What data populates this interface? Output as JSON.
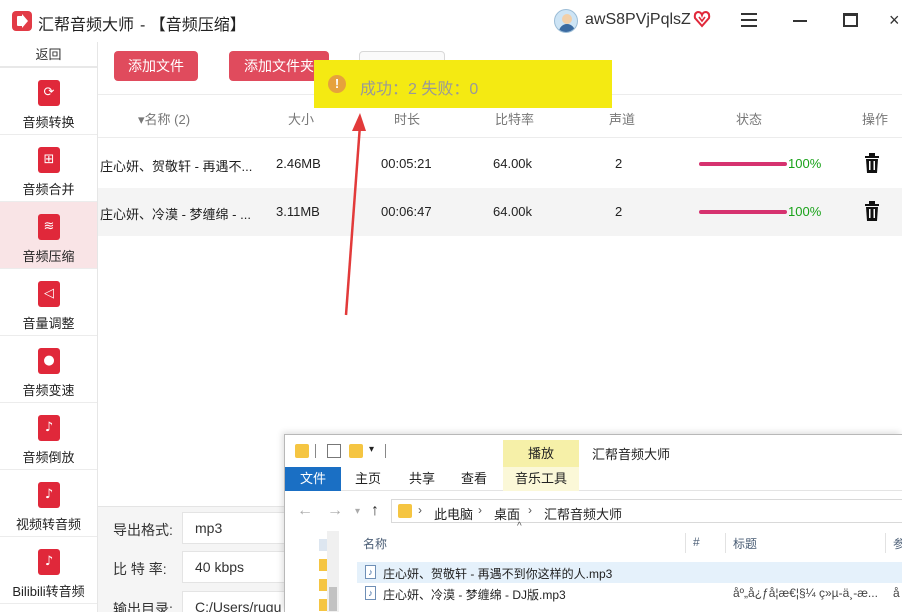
{
  "window": {
    "app_title": "汇帮音频大师",
    "page_tag": "-  【音频压缩】",
    "username": "awS8PVjPqlsZ",
    "close_glyph": "×"
  },
  "sidebar": {
    "back_label": "返回",
    "items": [
      {
        "label": "音频转换",
        "icon": "audio-convert-icon",
        "active": false
      },
      {
        "label": "音频合并",
        "icon": "audio-merge-icon",
        "active": false
      },
      {
        "label": "音频压缩",
        "icon": "audio-compress-icon",
        "active": true
      },
      {
        "label": "音量调整",
        "icon": "volume-icon",
        "active": false
      },
      {
        "label": "音频变速",
        "icon": "microphone-icon",
        "active": false
      },
      {
        "label": "音频倒放",
        "icon": "music-note-icon",
        "active": false
      },
      {
        "label": "视频转音频",
        "icon": "music-note-icon",
        "active": false
      },
      {
        "label": "Bilibili转音频",
        "icon": "music-note-icon",
        "active": false
      }
    ]
  },
  "toolbar": {
    "add_file": "添加文件",
    "add_folder": "添加文件夹"
  },
  "toast": {
    "text": "成功：2    失败：0",
    "icon": "info-icon",
    "color": "#f4ea12"
  },
  "table": {
    "headers": {
      "name": "▾名称 (2)",
      "size": "大小",
      "duration": "时长",
      "bitrate": "比特率",
      "channels": "声道",
      "status": "状态",
      "action": "操作"
    },
    "rows": [
      {
        "name": "庄心妍、贺敬轩 - 再遇不...",
        "size": "2.46MB",
        "duration": "00:05:21",
        "bitrate": "64.00k",
        "channels": "2",
        "progress": 1.0,
        "percent": "100%"
      },
      {
        "name": "庄心妍、冷漠 - 梦缠绵 - ...",
        "size": "3.11MB",
        "duration": "00:06:47",
        "bitrate": "64.00k",
        "channels": "2",
        "progress": 1.0,
        "percent": "100%"
      }
    ]
  },
  "settings": {
    "format_label": "导出格式:",
    "format_value": "mp3",
    "bitrate_label": "比 特 率:",
    "bitrate_value": "40 kbps",
    "output_label": "输出目录:",
    "output_value": "C:/Users/rugu"
  },
  "explorer": {
    "context_tab": "播放",
    "window_title": "汇帮音频大师",
    "ribbon_tabs": [
      "文件",
      "主页",
      "共享",
      "查看",
      "音乐工具"
    ],
    "breadcrumbs": [
      "此电脑",
      "桌面",
      "汇帮音频大师"
    ],
    "columns": [
      "名称",
      "#",
      "标题",
      "参"
    ],
    "files": [
      {
        "name": "庄心妍、贺敬轩 - 再遇不到你这样的人.mp3",
        "title": "",
        "extra": "",
        "selected": true
      },
      {
        "name": "庄心妍、冷漠 - 梦缠绵 - DJ版.mp3",
        "title": "åº„å¿ƒå¦æ€¦§¼ ç»µ-ä¸-æ...",
        "extra": "å",
        "selected": false
      }
    ]
  },
  "colors": {
    "accent": "#e04b5d",
    "progress": "#d6326f",
    "percent": "#1aa21a",
    "active_bg": "#f9e4e6"
  }
}
